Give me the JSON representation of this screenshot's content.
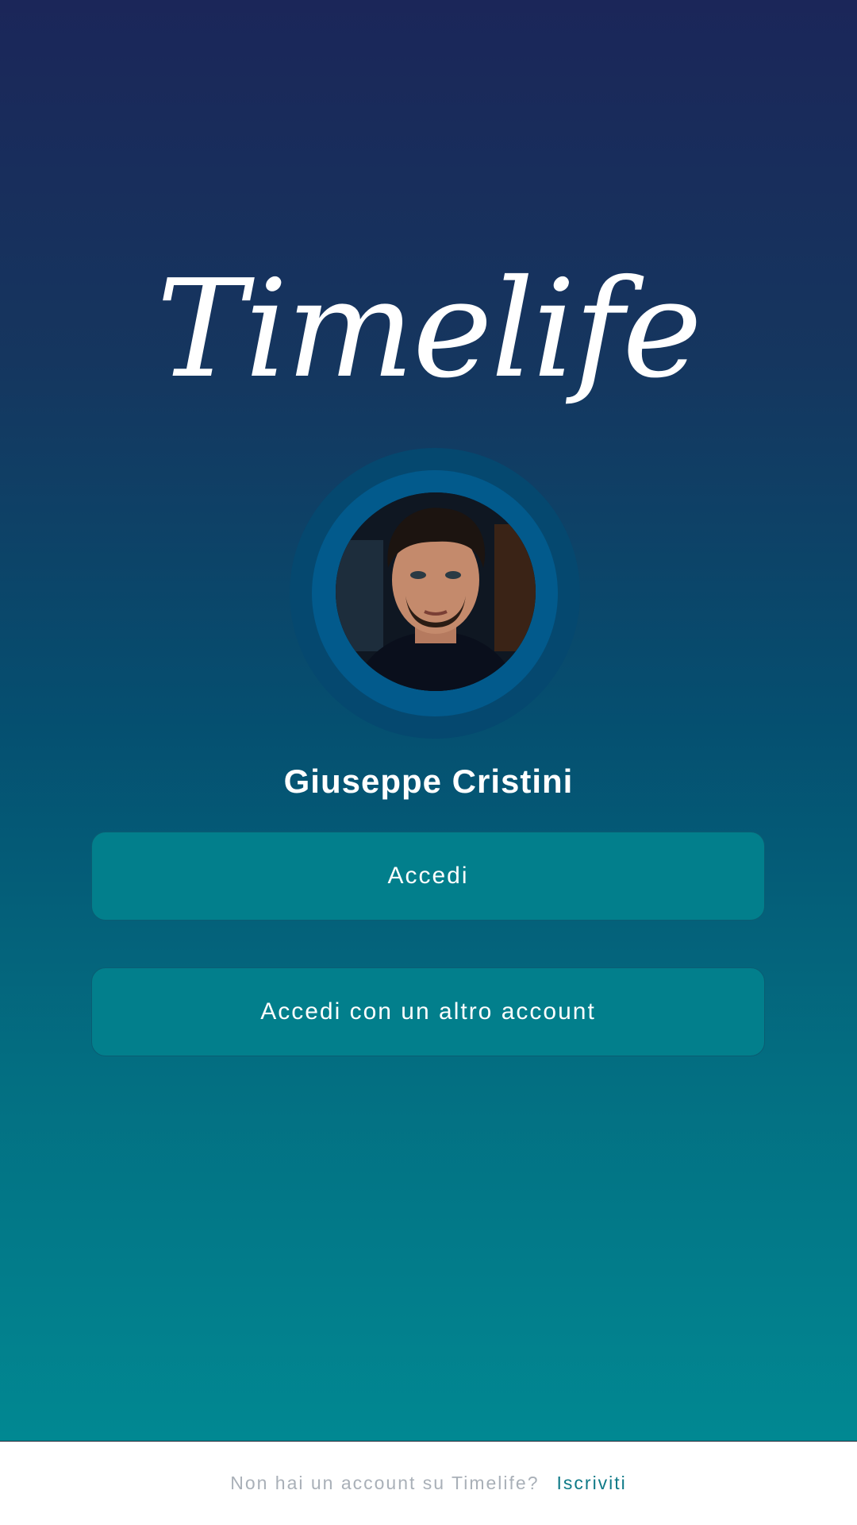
{
  "app": {
    "logo_text": "Timelife"
  },
  "profile": {
    "name": "Giuseppe Cristini",
    "avatar_icon": "user-photo"
  },
  "actions": {
    "login_label": "Accedi",
    "other_account_label": "Accedi con un altro account"
  },
  "footer": {
    "prompt": "Non hai un account su Timelife?",
    "signup_label": "Iscriviti"
  },
  "colors": {
    "gradient_top": "#1b2659",
    "gradient_bottom": "#018892",
    "button": "#027f8c",
    "avatar_ring": "#025a8c",
    "link": "#0e7a87"
  }
}
